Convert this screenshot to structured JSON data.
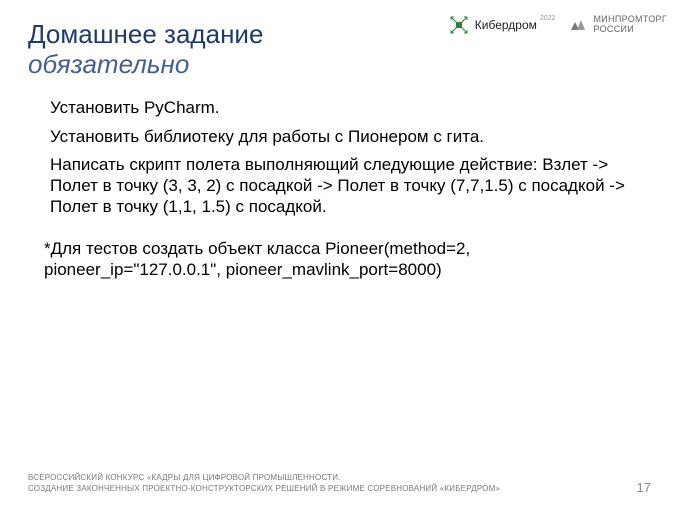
{
  "header": {
    "title": "Домашнее задание",
    "subtitle": "обязательно"
  },
  "logos": {
    "kiberdrom_label": "Кибердром",
    "kiberdrom_year": "2022",
    "minprom_line1": "МИНПРОМТОРГ",
    "minprom_line2": "РОССИИ"
  },
  "body": {
    "p1": "Установить PyCharm.",
    "p2": "Установить библиотеку для работы с Пионером с гита.",
    "p3": "Написать скрипт полета выполняющий следующие действие: Взлет  -> Полет в точку (3, 3, 2) с посадкой -> Полет в точку (7,7,1.5) с посадкой -> Полет в точку (1,1, 1.5) с посадкой."
  },
  "note": "*Для тестов создать объект класса Pioneer(method=2, pioneer_ip=\"127.0.0.1\", pioneer_mavlink_port=8000)",
  "footer": {
    "line1": "ВСЕРОССИЙСКИЙ КОНКУРС «КАДРЫ ДЛЯ ЦИФРОВОЙ ПРОМЫШЛЕННОСТИ.",
    "line2": "СОЗДАНИЕ ЗАКОНЧЕННЫХ ПРОЕКТНО-КОНСТРУКТОРСКИХ РЕШЕНИЙ В РЕЖИМЕ СОРЕВНОВАНИЙ «КИБЕРДРОМ»",
    "page": "17"
  }
}
